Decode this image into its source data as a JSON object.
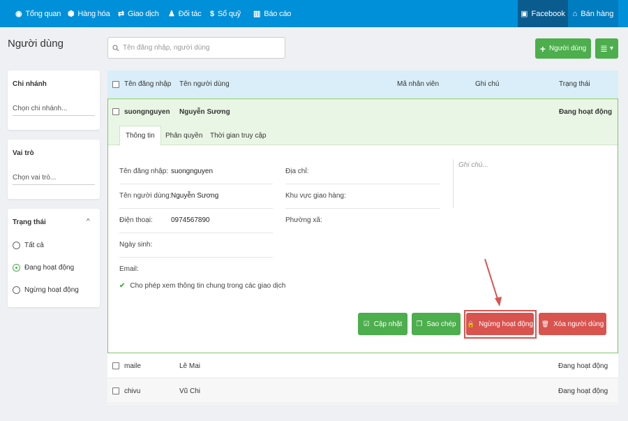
{
  "nav": {
    "items": [
      {
        "icon": "gauge-icon",
        "glyph": "◉",
        "label": "Tổng quan"
      },
      {
        "icon": "box-icon",
        "glyph": "⬢",
        "label": "Hàng hóa"
      },
      {
        "icon": "exchange-icon",
        "glyph": "⇄",
        "label": "Giao dịch"
      },
      {
        "icon": "user-icon",
        "glyph": "♟",
        "label": "Đối tác"
      },
      {
        "icon": "money-icon",
        "glyph": "$",
        "label": "Sổ quỹ"
      },
      {
        "icon": "chart-icon",
        "glyph": "▥",
        "label": "Báo cáo"
      }
    ],
    "facebook": {
      "glyph": "▣",
      "label": "Facebook"
    },
    "sell": {
      "glyph": "⌂",
      "label": "Bán hàng"
    }
  },
  "page": {
    "title": "Người dùng"
  },
  "search": {
    "placeholder": "Tên đăng nhập, người dùng"
  },
  "toolbar": {
    "add_label": "Người dùng",
    "add_glyph": "+",
    "cols_glyph": "≣",
    "caret": "▾"
  },
  "filters": {
    "branch": {
      "title": "Chi nhánh",
      "placeholder": "Chọn chi nhánh..."
    },
    "role": {
      "title": "Vai trò",
      "placeholder": "Chọn vai trò..."
    },
    "status": {
      "title": "Trạng thái",
      "toggle": "^",
      "options": [
        {
          "label": "Tất cả",
          "selected": false
        },
        {
          "label": "Đang hoạt động",
          "selected": true
        },
        {
          "label": "Ngừng hoạt động",
          "selected": false
        }
      ]
    }
  },
  "table": {
    "headers": {
      "username": "Tên đăng nhập",
      "name": "Tên người dùng",
      "code": "Mã nhân viên",
      "note": "Ghi chú",
      "status": "Trạng thái"
    },
    "expanded": {
      "username": "suongnguyen",
      "name": "Nguyễn Sương",
      "status": "Đang hoạt động",
      "tabs": [
        "Thông tin",
        "Phân quyền",
        "Thời gian truy cập"
      ],
      "fields": {
        "username_label": "Tên đăng nhập:",
        "username_value": "suongnguyen",
        "name_label": "Tên người dùng:",
        "name_value": "Nguyễn Sương",
        "phone_label": "Điện thoại:",
        "phone_value": "0974567890",
        "dob_label": "Ngày sinh:",
        "email_label": "Email:",
        "address_label": "Địa chỉ:",
        "area_label": "Khu vực giao hàng:",
        "ward_label": "Phường xã:",
        "note_placeholder": "Ghi chú...",
        "share_check": "✔",
        "share_label": "Cho phép xem thông tin chung trong các giao dịch"
      },
      "actions": {
        "update": {
          "glyph": "☑",
          "label": "Cập nhật"
        },
        "copy": {
          "glyph": "❐",
          "label": "Sao chép"
        },
        "deactivate": {
          "glyph": "🔒",
          "label": "Ngừng hoạt động"
        },
        "delete": {
          "glyph": "🗑",
          "label": "Xóa người dùng"
        }
      }
    },
    "rows": [
      {
        "username": "maile",
        "name": "Lê Mai",
        "status": "Đang hoạt động"
      },
      {
        "username": "chivu",
        "name": "Vũ Chi",
        "status": "Đang hoạt động"
      }
    ]
  },
  "colors": {
    "nav": "#0090da",
    "green": "#4cae4c",
    "blue_btn": "#0aa0cf",
    "red": "#d9534f",
    "highlight": "#d9534f"
  }
}
